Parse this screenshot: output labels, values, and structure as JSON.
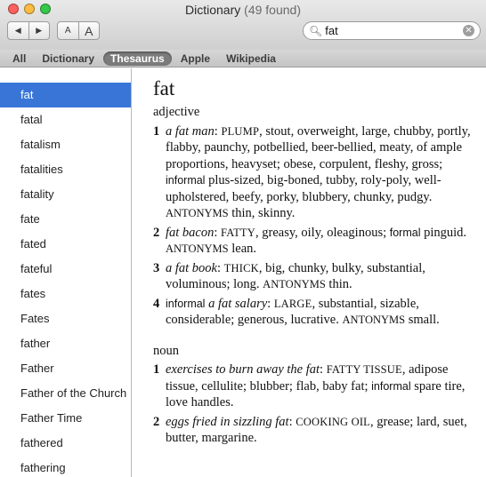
{
  "window": {
    "title": "Dictionary",
    "count": "(49 found)"
  },
  "toolbar": {
    "back": "◀",
    "forward": "▶",
    "font_smaller": "A",
    "font_larger": "A"
  },
  "search": {
    "value": "fat"
  },
  "scopes": [
    "All",
    "Dictionary",
    "Thesaurus",
    "Apple",
    "Wikipedia"
  ],
  "results": [
    "fat",
    "fatal",
    "fatalism",
    "fatalities",
    "fatality",
    "fate",
    "fated",
    "fateful",
    "fates",
    "Fates",
    "father",
    "Father",
    "Father of the Church",
    "Father Time",
    "fathered",
    "fathering"
  ],
  "entry": {
    "headword": "fat",
    "adjective": "adjective",
    "adj_senses": [
      {
        "num": "1",
        "ex": "a fat man",
        "syn": "PLUMP",
        "pre": ", stout, overweight, large, chubby, portly, flabby, paunchy, potbellied, beer-bellied, meaty, of ample proportions, heavyset; obese, corpulent, fleshy, gross; ",
        "reg": "informal",
        "post": " plus-sized, big-boned, tubby, roly-poly, well-upholstered, beefy, porky, blubbery, chunky, pudgy. ",
        "ant_label": "ANTONYMS",
        "ant": " thin, skinny."
      },
      {
        "num": "2",
        "ex": "fat bacon",
        "syn": "FATTY",
        "pre": ", greasy, oily, oleaginous; ",
        "reg": "formal",
        "post": " pinguid. ",
        "ant_label": "ANTONYMS",
        "ant": " lean."
      },
      {
        "num": "3",
        "ex": "a fat book",
        "syn": "THICK",
        "pre": ", big, chunky, bulky, substantial, voluminous; long. ",
        "ant_label": "ANTONYMS",
        "ant": " thin."
      },
      {
        "num": "4",
        "lead_reg": "informal",
        "ex": "a fat salary",
        "syn": "LARGE",
        "pre": ", substantial, sizable, considerable; generous, lucrative. ",
        "ant_label": "ANTONYMS",
        "ant": " small."
      }
    ],
    "noun": "noun",
    "noun_senses": [
      {
        "num": "1",
        "ex": "exercises to burn away the fat",
        "syn": "FATTY TISSUE",
        "pre": ", adipose tissue, cellulite; blubber; flab, baby fat; ",
        "reg": "informal",
        "post": " spare tire, love handles."
      },
      {
        "num": "2",
        "ex": "eggs fried in sizzling fat",
        "syn": "COOKING OIL",
        "pre": ", grease; lard, suet, butter, margarine."
      }
    ]
  }
}
